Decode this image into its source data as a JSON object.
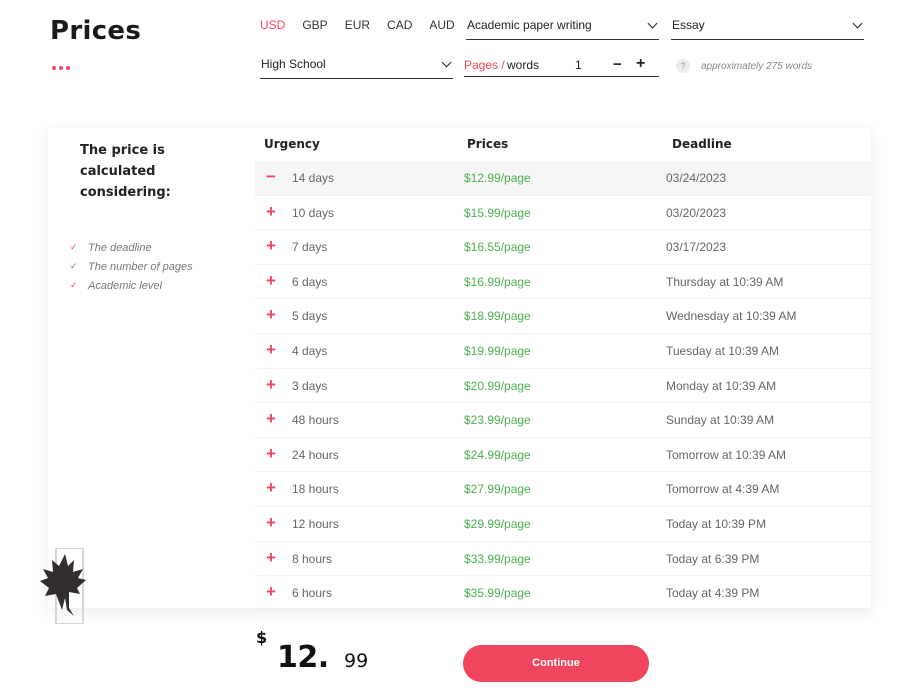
{
  "page": {
    "title": "Prices",
    "accent_color": "#f0455e",
    "price_color": "#4caf50"
  },
  "controls": {
    "currencies": [
      "USD",
      "GBP",
      "EUR",
      "CAD",
      "AUD"
    ],
    "selected_currency": "USD",
    "paper_service": "Academic paper writing",
    "paper_type": "Essay",
    "academic_level": "High School",
    "pages_label": "Pages /",
    "words_label": "words",
    "pages_count": "1",
    "minus_label": "−",
    "plus_label": "+",
    "help_icon_label": "?",
    "approx_words": "approximately 275 words"
  },
  "sidebar": {
    "title": "The price is calculated considering:",
    "criteria": [
      "The deadline",
      "The number of pages",
      "Academic level"
    ],
    "check_icon": "check-icon",
    "logo_icon": "maple-leaf-icon"
  },
  "table": {
    "headers": {
      "urgency": "Urgency",
      "prices": "Prices",
      "deadline": "Deadline"
    },
    "selected_index": 0,
    "rows": [
      {
        "urgency": "14 days",
        "price": "$12.99/page",
        "deadline": "03/24/2023"
      },
      {
        "urgency": "10 days",
        "price": "$15.99/page",
        "deadline": "03/20/2023"
      },
      {
        "urgency": "7 days",
        "price": "$16.55/page",
        "deadline": "03/17/2023"
      },
      {
        "urgency": "6 days",
        "price": "$16.99/page",
        "deadline": "Thursday at 10:39 AM"
      },
      {
        "urgency": "5 days",
        "price": "$18.99/page",
        "deadline": "Wednesday at 10:39 AM"
      },
      {
        "urgency": "4 days",
        "price": "$19.99/page",
        "deadline": "Tuesday at 10:39 AM"
      },
      {
        "urgency": "3 days",
        "price": "$20.99/page",
        "deadline": "Monday at 10:39 AM"
      },
      {
        "urgency": "48 hours",
        "price": "$23.99/page",
        "deadline": "Sunday at 10:39 AM"
      },
      {
        "urgency": "24 hours",
        "price": "$24.99/page",
        "deadline": "Tomorrow at 10:39 AM"
      },
      {
        "urgency": "18 hours",
        "price": "$27.99/page",
        "deadline": "Tomorrow at 4:39 AM"
      },
      {
        "urgency": "12 hours",
        "price": "$29.99/page",
        "deadline": "Today at 10:39 PM"
      },
      {
        "urgency": "8 hours",
        "price": "$33.99/page",
        "deadline": "Today at 6:39 PM"
      },
      {
        "urgency": "6 hours",
        "price": "$35.99/page",
        "deadline": "Today at 4:39 PM"
      }
    ]
  },
  "total": {
    "currency_symbol": "$",
    "integer": "12.",
    "decimal": "99"
  },
  "continue_label": "Continue"
}
